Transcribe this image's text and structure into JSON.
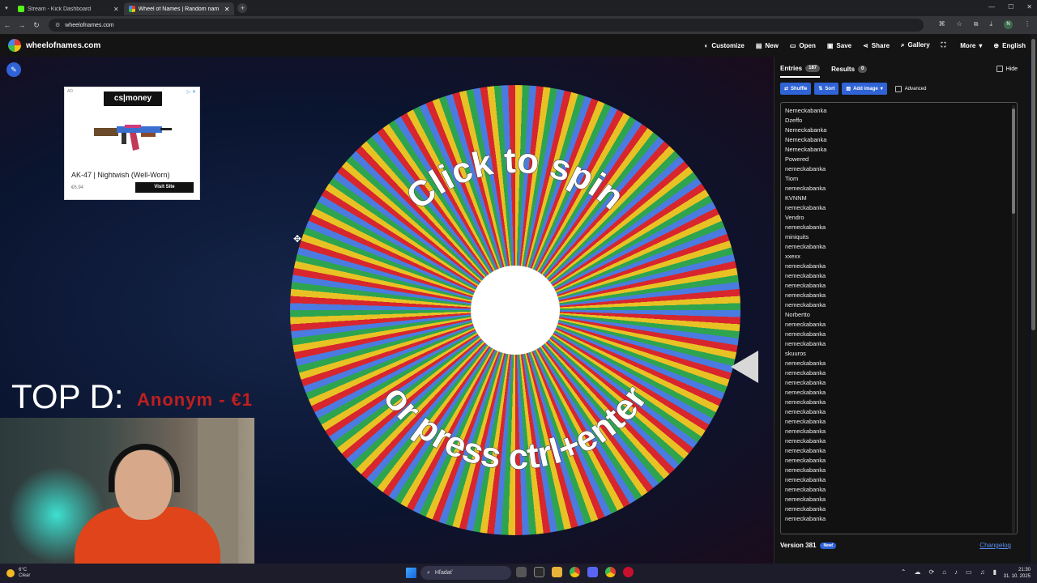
{
  "browser": {
    "tabs": [
      {
        "title": "Stream - Kick Dashboard",
        "active": false,
        "favicon_color": "#53fc18"
      },
      {
        "title": "Wheel of Names | Random nam",
        "active": true,
        "favicon_color": "#4885ed"
      }
    ],
    "url": "wheelofnames.com"
  },
  "site": {
    "name": "wheelofnames.com",
    "menu": [
      "Customize",
      "New",
      "Open",
      "Save",
      "Share",
      "Gallery",
      "More",
      "English"
    ]
  },
  "ad": {
    "tag": "AD",
    "brand": "cs|money",
    "product": "AK-47 | Nightwish (Well-Worn)",
    "price": "€6.94",
    "cta": "Visit Site"
  },
  "overlay": {
    "top_label": "TOP D:",
    "top_name": "Anonym - €1"
  },
  "wheel": {
    "line1": "Click to spin",
    "line2": "or press ctrl+enter",
    "colors": [
      "#e8c224",
      "#2ea44f",
      "#4b7be0",
      "#d7262e"
    ]
  },
  "panel": {
    "entries_tab": "Entries",
    "entries_count": "187",
    "results_tab": "Results",
    "results_count": "0",
    "hide_label": "Hide",
    "shuffle_label": "Shuffle",
    "sort_label": "Sort",
    "add_image_label": "Add image",
    "advanced_label": "Advanced",
    "entries": [
      "Nemeckabanka",
      "Dzeffo",
      "Nemeckabanka",
      "Nemeckabanka",
      "Nemeckabanka",
      "Powered",
      "nemeckabanka",
      "Tiom",
      "nemeckabanka",
      "KVNNM",
      "nemeckabanka",
      "Vendro",
      "nemeckabanka",
      "miniquits",
      "nemeckabanka",
      "xxexx",
      "nemeckabanka",
      "nemeckabanka",
      "nemeckabanka",
      "nemeckabanka",
      "nemeckabanka",
      "Norbertto",
      "nemeckabanka",
      "nemeckabanka",
      "nemeckabanka",
      "skuuros",
      "nemeckabanka",
      "nemeckabanka",
      "nemeckabanka",
      "nemeckabanka",
      "nemeckabanka",
      "nemeckabanka",
      "nemeckabanka",
      "nemeckabanka",
      "nemeckabanka",
      "nemeckabanka",
      "nemeckabanka",
      "nemeckabanka",
      "nemeckabanka",
      "nemeckabanka",
      "nemeckabanka",
      "nemeckabanka",
      "nemeckabanka"
    ],
    "version": "Version 381",
    "new_badge": "New!",
    "changelog": "Changelog"
  },
  "taskbar": {
    "temp": "6°C",
    "weather": "Clear",
    "search": "Hľadať",
    "time": "21:30",
    "date": "31. 10. 2025"
  }
}
